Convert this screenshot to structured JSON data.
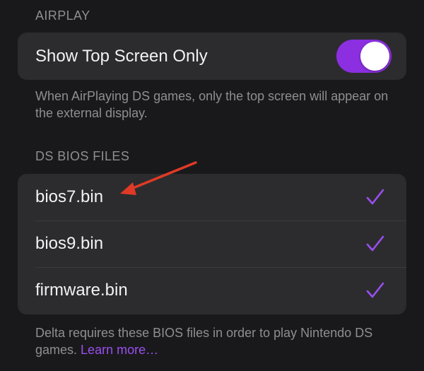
{
  "airplay": {
    "header": "AIRPLAY",
    "show_top_screen_label": "Show Top Screen Only",
    "show_top_screen_enabled": true,
    "footer": "When AirPlaying DS games, only the top screen will appear on the external display."
  },
  "bios": {
    "header": "DS BIOS FILES",
    "files": [
      {
        "name": "bios7.bin",
        "checked": true
      },
      {
        "name": "bios9.bin",
        "checked": true
      },
      {
        "name": "firmware.bin",
        "checked": true
      }
    ],
    "footer_text": "Delta requires these BIOS files in order to play Nintendo DS games.",
    "learn_more": "Learn more…"
  },
  "colors": {
    "background": "#19191b",
    "cell": "#2c2c2e",
    "accent": "#9a4ff0",
    "toggle_on": "#8b2fe0",
    "annotation_arrow": "#e03a26"
  },
  "icons": {
    "checkmark": "checkmark-icon",
    "annotation": "red-arrow-icon"
  }
}
